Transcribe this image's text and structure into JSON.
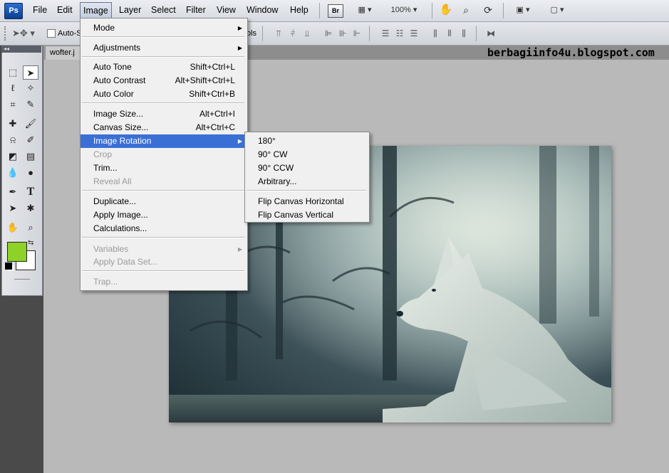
{
  "app": {
    "logo": "Ps"
  },
  "menubar": {
    "items": [
      "File",
      "Edit",
      "Image",
      "Layer",
      "Select",
      "Filter",
      "View",
      "Window",
      "Help"
    ],
    "bridge": "Br",
    "zoom": "100%"
  },
  "options": {
    "auto_select": "Auto-S",
    "show_transform": "ols"
  },
  "toolbox": {
    "collapse": "◂◂"
  },
  "document": {
    "tab": "wofter.j"
  },
  "watermark": "berbagiinfo4u.blogspot.com",
  "image_menu": {
    "mode": "Mode",
    "adjustments": "Adjustments",
    "auto_tone": "Auto Tone",
    "auto_tone_sc": "Shift+Ctrl+L",
    "auto_contrast": "Auto Contrast",
    "auto_contrast_sc": "Alt+Shift+Ctrl+L",
    "auto_color": "Auto Color",
    "auto_color_sc": "Shift+Ctrl+B",
    "image_size": "Image Size...",
    "image_size_sc": "Alt+Ctrl+I",
    "canvas_size": "Canvas Size...",
    "canvas_size_sc": "Alt+Ctrl+C",
    "image_rotation": "Image Rotation",
    "crop": "Crop",
    "trim": "Trim...",
    "reveal_all": "Reveal All",
    "duplicate": "Duplicate...",
    "apply_image": "Apply Image...",
    "calculations": "Calculations...",
    "variables": "Variables",
    "apply_data_set": "Apply Data Set...",
    "trap": "Trap..."
  },
  "rotation_menu": {
    "r180": "180°",
    "r90cw": "90° CW",
    "r90ccw": "90° CCW",
    "arbitrary": "Arbitrary...",
    "flip_h": "Flip Canvas Horizontal",
    "flip_v": "Flip Canvas Vertical"
  },
  "colors": {
    "foreground": "#8ed127",
    "background": "#ffffff",
    "highlight": "#3a6fd6"
  }
}
